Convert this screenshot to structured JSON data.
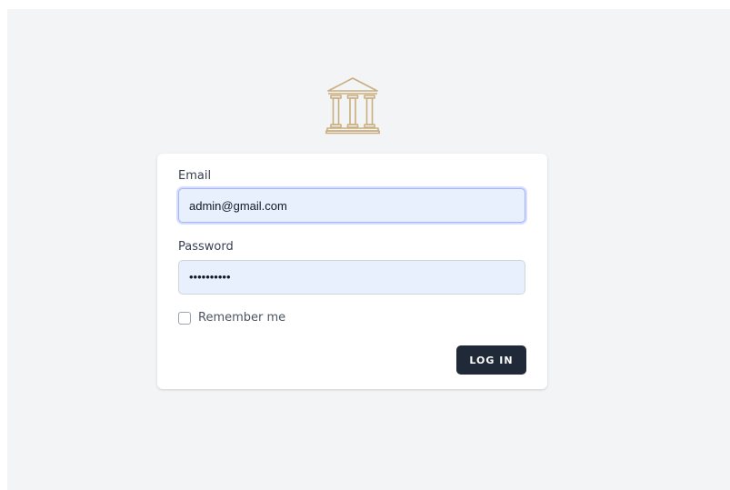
{
  "logo": {
    "icon": "bank-building-icon",
    "color": "#c9ae7f"
  },
  "form": {
    "email_label": "Email",
    "email_value": "admin@gmail.com",
    "password_label": "Password",
    "password_value": "••••••••••",
    "remember_label": "Remember me",
    "remember_checked": false,
    "login_label": "LOG IN"
  },
  "colors": {
    "page_background": "#f3f4f6",
    "input_background": "#e8f0fe",
    "button_background": "#1f2937"
  }
}
